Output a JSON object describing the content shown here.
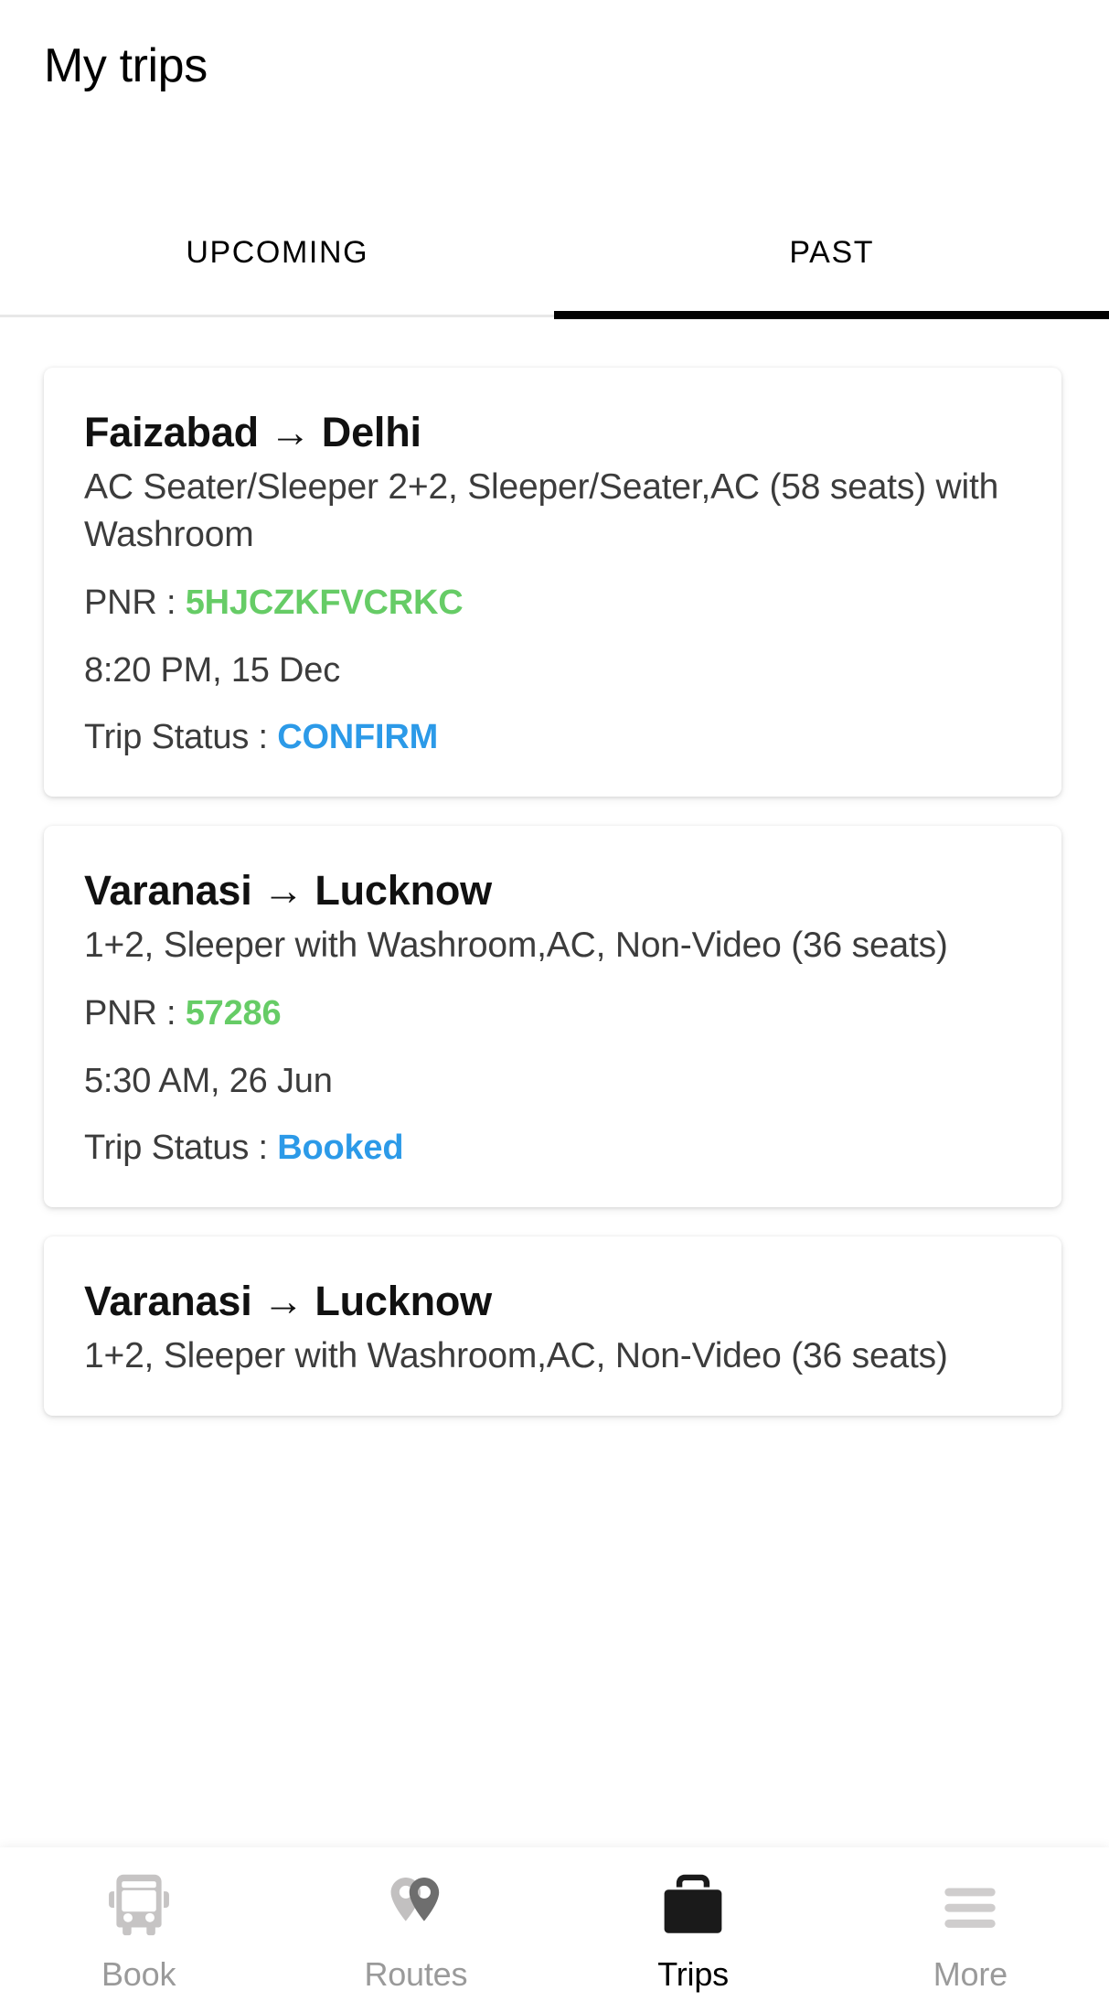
{
  "header": {
    "title": "My trips"
  },
  "tabs": {
    "items": [
      {
        "label": "UPCOMING",
        "active": false
      },
      {
        "label": "PAST",
        "active": true
      }
    ]
  },
  "labels": {
    "pnr_prefix": "PNR : ",
    "status_prefix": "Trip Status : ",
    "arrow": "→"
  },
  "colors": {
    "pnr_green": "#66cc66",
    "status_blue": "#2c9ae8",
    "active_tab": "#000000",
    "muted_text": "#3c3c3c",
    "nav_inactive": "#c6c4c4",
    "nav_active": "#1a1a1a"
  },
  "trips": [
    {
      "from": "Faizabad",
      "to": "Delhi",
      "bus_description": "AC Seater/Sleeper 2+2, Sleeper/Seater,AC (58 seats) with Washroom",
      "pnr": "5HJCZKFVCRKC",
      "departure": "8:20 PM, 15 Dec",
      "status": "CONFIRM"
    },
    {
      "from": "Varanasi",
      "to": "Lucknow",
      "bus_description": "1+2, Sleeper with Washroom,AC, Non-Video (36 seats)",
      "pnr": "57286",
      "departure": "5:30 AM, 26 Jun",
      "status": "Booked"
    },
    {
      "from": "Varanasi",
      "to": "Lucknow",
      "bus_description": "1+2, Sleeper with Washroom,AC, Non-Video (36 seats)",
      "pnr": "",
      "departure": "",
      "status": ""
    }
  ],
  "bottom_nav": {
    "items": [
      {
        "label": "Book",
        "icon": "bus-icon",
        "active": false
      },
      {
        "label": "Routes",
        "icon": "map-pins-icon",
        "active": false
      },
      {
        "label": "Trips",
        "icon": "briefcase-icon",
        "active": true
      },
      {
        "label": "More",
        "icon": "hamburger-icon",
        "active": false
      }
    ]
  }
}
